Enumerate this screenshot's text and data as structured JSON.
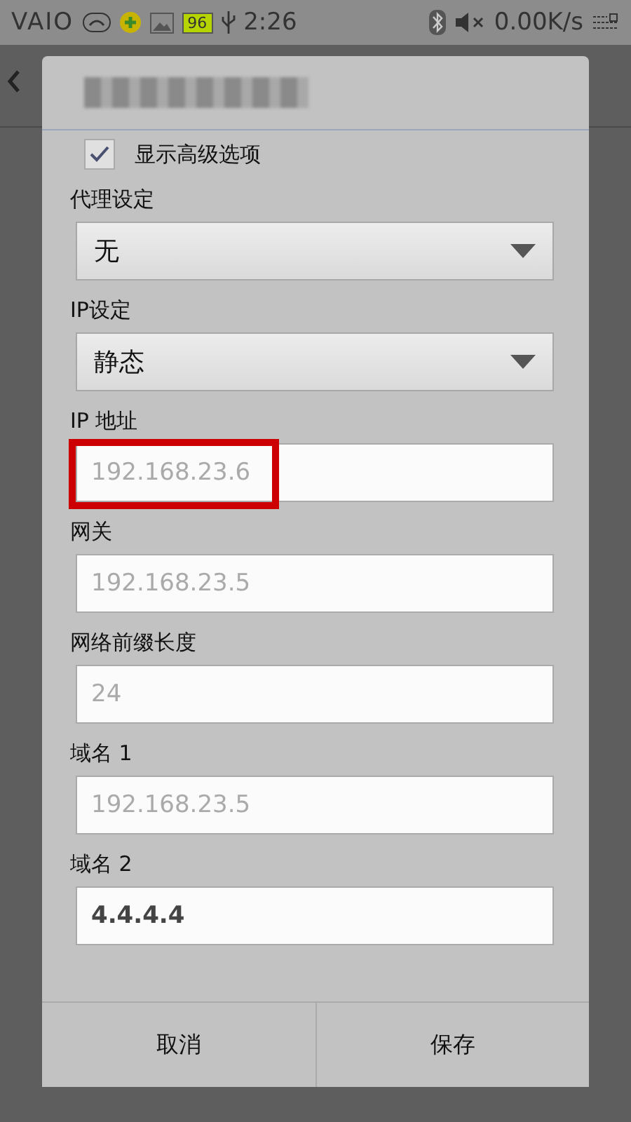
{
  "status_bar": {
    "brand": "VAIO",
    "battery": "96",
    "time": "2:26",
    "net_speed": "0.00K/s"
  },
  "dialog": {
    "show_advanced": {
      "label": "显示高级选项",
      "checked": true
    },
    "fields": [
      {
        "kind": "spinner",
        "label": "代理设定",
        "value": "无"
      },
      {
        "kind": "spinner",
        "label": "IP设定",
        "value": "静态"
      },
      {
        "kind": "text",
        "label": "IP 地址",
        "placeholder": "192.168.23.6",
        "highlighted": true
      },
      {
        "kind": "text",
        "label": "网关",
        "placeholder": "192.168.23.5",
        "highlighted": false
      },
      {
        "kind": "text",
        "label": "网络前缀长度",
        "placeholder": "24",
        "highlighted": false
      },
      {
        "kind": "text",
        "label": "域名 1",
        "placeholder": "192.168.23.5",
        "highlighted": false
      },
      {
        "kind": "text",
        "label": "域名 2",
        "value": "4.4.4.4",
        "highlighted": false
      }
    ],
    "buttons": [
      "取消",
      "保存"
    ]
  }
}
